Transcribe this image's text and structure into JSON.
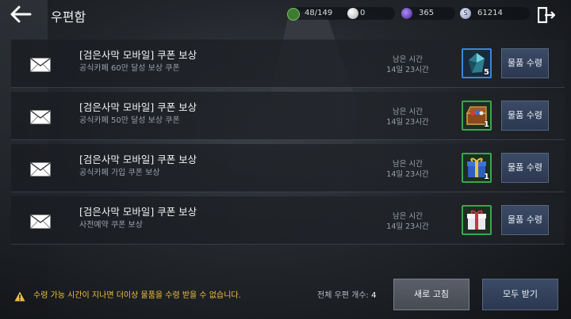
{
  "header": {
    "title": "우편함",
    "resources": [
      {
        "name": "energy",
        "value": "48/149",
        "color": "#5fa04a"
      },
      {
        "name": "pearl",
        "value": "0",
        "color": "#d9d9d9"
      },
      {
        "name": "dark-crystal",
        "value": "365",
        "color": "#7a4fd0"
      },
      {
        "name": "silver",
        "value": "61214",
        "color": "#b8c0d8"
      }
    ]
  },
  "mails": [
    {
      "title": "[검은사막 모바일] 쿠폰 보상",
      "subtitle": "공식카페 60만 달성 보상 쿠폰",
      "remain_label": "남은 시간",
      "remain_value": "14일 23시간",
      "item_count": "5",
      "item_icon": "blue-gem-icon",
      "grade_color": "#3c86d8",
      "button": "물품 수령"
    },
    {
      "title": "[검은사막 모바일] 쿠폰 보상",
      "subtitle": "공식카페 50만 달성 보상 쿠폰",
      "remain_label": "남은 시간",
      "remain_value": "14일 23시간",
      "item_count": "1",
      "item_icon": "treasure-chest-icon",
      "grade_color": "#3aa64d",
      "button": "물품 수령"
    },
    {
      "title": "[검은사막 모바일] 쿠폰 보상",
      "subtitle": "공식카페 가입 쿠폰 보상",
      "remain_label": "남은 시간",
      "remain_value": "14일 23시간",
      "item_count": "1",
      "item_icon": "blue-gift-box-icon",
      "grade_color": "#3aa64d",
      "button": "물품 수령"
    },
    {
      "title": "[검은사막 모바일] 쿠폰 보상",
      "subtitle": "사전예약 쿠폰 보상",
      "remain_label": "남은 시간",
      "remain_value": "14일 23시간",
      "item_count": "",
      "item_icon": "white-gift-box-icon",
      "grade_color": "#3aa64d",
      "button": "물품 수령"
    }
  ],
  "footer": {
    "warning": "수령 가능 시간이 지나면 더이상 물품을 수령 받을 수 없습니다.",
    "total_label": "전체 우편 개수:",
    "total_value": "4",
    "refresh_button": "새로 고침",
    "receive_all_button": "모두 받기"
  }
}
